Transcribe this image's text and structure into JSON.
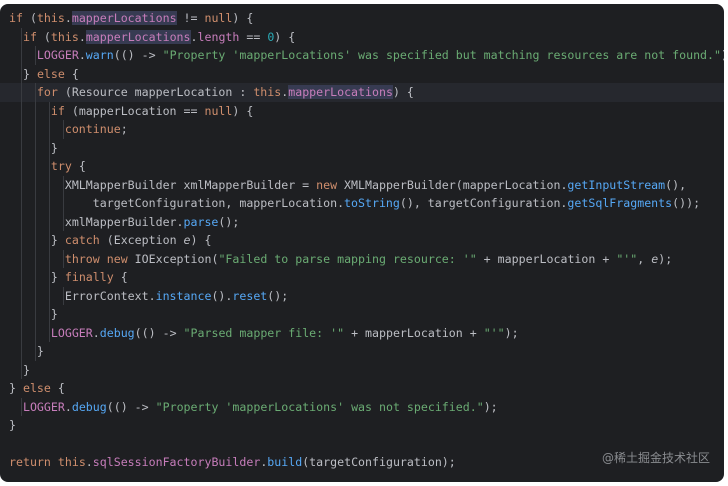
{
  "theme": {
    "background": "#1e1f22",
    "keyword": "#cf8e6d",
    "string": "#6aab73",
    "number": "#2aacb8",
    "field": "#c77dbb",
    "method": "#56a8f5",
    "text": "#bcbec4",
    "line_highlight": "#26282e"
  },
  "code_lines": [
    {
      "indent": 0,
      "tokens": [
        [
          "kw",
          "if"
        ],
        [
          "plain",
          " ("
        ],
        [
          "kw",
          "this"
        ],
        [
          "plain",
          "."
        ],
        [
          "fld-hl",
          "mapperLocations"
        ],
        [
          "plain",
          " != "
        ],
        [
          "kw",
          "null"
        ],
        [
          "plain",
          ") {"
        ]
      ]
    },
    {
      "indent": 1,
      "tokens": [
        [
          "kw",
          "if"
        ],
        [
          "plain",
          " ("
        ],
        [
          "kw",
          "this"
        ],
        [
          "plain",
          "."
        ],
        [
          "fld-hl",
          "mapperLocations"
        ],
        [
          "plain",
          "."
        ],
        [
          "fld",
          "length"
        ],
        [
          "plain",
          " == "
        ],
        [
          "num",
          "0"
        ],
        [
          "plain",
          ") {"
        ]
      ]
    },
    {
      "indent": 2,
      "tokens": [
        [
          "const-fld",
          "LOGGER"
        ],
        [
          "plain",
          "."
        ],
        [
          "mth",
          "warn"
        ],
        [
          "plain",
          "(() -> "
        ],
        [
          "str",
          "\"Property 'mapperLocations' was specified but matching resources are not found.\""
        ],
        [
          "plain",
          ");"
        ]
      ]
    },
    {
      "indent": 1,
      "tokens": [
        [
          "plain",
          "} "
        ],
        [
          "kw",
          "else"
        ],
        [
          "plain",
          " {"
        ]
      ]
    },
    {
      "indent": 2,
      "highlight": true,
      "tokens": [
        [
          "kw",
          "for"
        ],
        [
          "plain",
          " (Resource mapperLocation : "
        ],
        [
          "kw",
          "this"
        ],
        [
          "plain",
          "."
        ],
        [
          "fld-hl",
          "mapperLocations"
        ],
        [
          "plain",
          ") {"
        ]
      ]
    },
    {
      "indent": 3,
      "tokens": [
        [
          "kw",
          "if"
        ],
        [
          "plain",
          " (mapperLocation == "
        ],
        [
          "kw",
          "null"
        ],
        [
          "plain",
          ") {"
        ]
      ]
    },
    {
      "indent": 4,
      "tokens": [
        [
          "kw",
          "continue"
        ],
        [
          "plain",
          ";"
        ]
      ]
    },
    {
      "indent": 3,
      "tokens": [
        [
          "plain",
          "}"
        ]
      ]
    },
    {
      "indent": 3,
      "tokens": [
        [
          "kw",
          "try"
        ],
        [
          "plain",
          " {"
        ]
      ]
    },
    {
      "indent": 4,
      "tokens": [
        [
          "plain",
          "XMLMapperBuilder xmlMapperBuilder = "
        ],
        [
          "kw",
          "new"
        ],
        [
          "plain",
          " XMLMapperBuilder(mapperLocation."
        ],
        [
          "mth",
          "getInputStream"
        ],
        [
          "plain",
          "(),"
        ]
      ]
    },
    {
      "indent": 6,
      "tokens": [
        [
          "plain",
          "targetConfiguration, mapperLocation."
        ],
        [
          "mth",
          "toString"
        ],
        [
          "plain",
          "(), targetConfiguration."
        ],
        [
          "mth",
          "getSqlFragments"
        ],
        [
          "plain",
          "());"
        ]
      ]
    },
    {
      "indent": 4,
      "tokens": [
        [
          "plain",
          "xmlMapperBuilder."
        ],
        [
          "mth",
          "parse"
        ],
        [
          "plain",
          "();"
        ]
      ]
    },
    {
      "indent": 3,
      "tokens": [
        [
          "plain",
          "} "
        ],
        [
          "kw",
          "catch"
        ],
        [
          "plain",
          " (Exception "
        ],
        [
          "param",
          "e"
        ],
        [
          "plain",
          ") {"
        ]
      ]
    },
    {
      "indent": 4,
      "tokens": [
        [
          "kw",
          "throw"
        ],
        [
          "plain",
          " "
        ],
        [
          "kw",
          "new"
        ],
        [
          "plain",
          " IOException("
        ],
        [
          "str",
          "\"Failed to parse mapping resource: '\""
        ],
        [
          "plain",
          " + mapperLocation + "
        ],
        [
          "str",
          "\"'\""
        ],
        [
          "plain",
          ", "
        ],
        [
          "param",
          "e"
        ],
        [
          "plain",
          ");"
        ]
      ]
    },
    {
      "indent": 3,
      "tokens": [
        [
          "plain",
          "} "
        ],
        [
          "kw",
          "finally"
        ],
        [
          "plain",
          " {"
        ]
      ]
    },
    {
      "indent": 4,
      "tokens": [
        [
          "plain",
          "ErrorContext."
        ],
        [
          "mth",
          "instance"
        ],
        [
          "plain",
          "()."
        ],
        [
          "mth",
          "reset"
        ],
        [
          "plain",
          "();"
        ]
      ]
    },
    {
      "indent": 3,
      "tokens": [
        [
          "plain",
          "}"
        ]
      ]
    },
    {
      "indent": 3,
      "tokens": [
        [
          "const-fld",
          "LOGGER"
        ],
        [
          "plain",
          "."
        ],
        [
          "mth",
          "debug"
        ],
        [
          "plain",
          "(() -> "
        ],
        [
          "str",
          "\"Parsed mapper file: '\""
        ],
        [
          "plain",
          " + mapperLocation + "
        ],
        [
          "str",
          "\"'\""
        ],
        [
          "plain",
          ");"
        ]
      ]
    },
    {
      "indent": 2,
      "tokens": [
        [
          "plain",
          "}"
        ]
      ]
    },
    {
      "indent": 1,
      "tokens": [
        [
          "plain",
          "}"
        ]
      ]
    },
    {
      "indent": 0,
      "tokens": [
        [
          "plain",
          "} "
        ],
        [
          "kw",
          "else"
        ],
        [
          "plain",
          " {"
        ]
      ]
    },
    {
      "indent": 1,
      "tokens": [
        [
          "const-fld",
          "LOGGER"
        ],
        [
          "plain",
          "."
        ],
        [
          "mth",
          "debug"
        ],
        [
          "plain",
          "(() -> "
        ],
        [
          "str",
          "\"Property 'mapperLocations' was not specified.\""
        ],
        [
          "plain",
          ");"
        ]
      ]
    },
    {
      "indent": 0,
      "tokens": [
        [
          "plain",
          "}"
        ]
      ]
    },
    {
      "indent": 0,
      "tokens": []
    },
    {
      "indent": 0,
      "tokens": [
        [
          "kw",
          "return"
        ],
        [
          "plain",
          " "
        ],
        [
          "kw",
          "this"
        ],
        [
          "plain",
          "."
        ],
        [
          "fld",
          "sqlSessionFactoryBuilder"
        ],
        [
          "plain",
          "."
        ],
        [
          "mth",
          "build"
        ],
        [
          "plain",
          "(targetConfiguration);"
        ]
      ]
    }
  ],
  "watermark": "@稀土掘金技术社区"
}
